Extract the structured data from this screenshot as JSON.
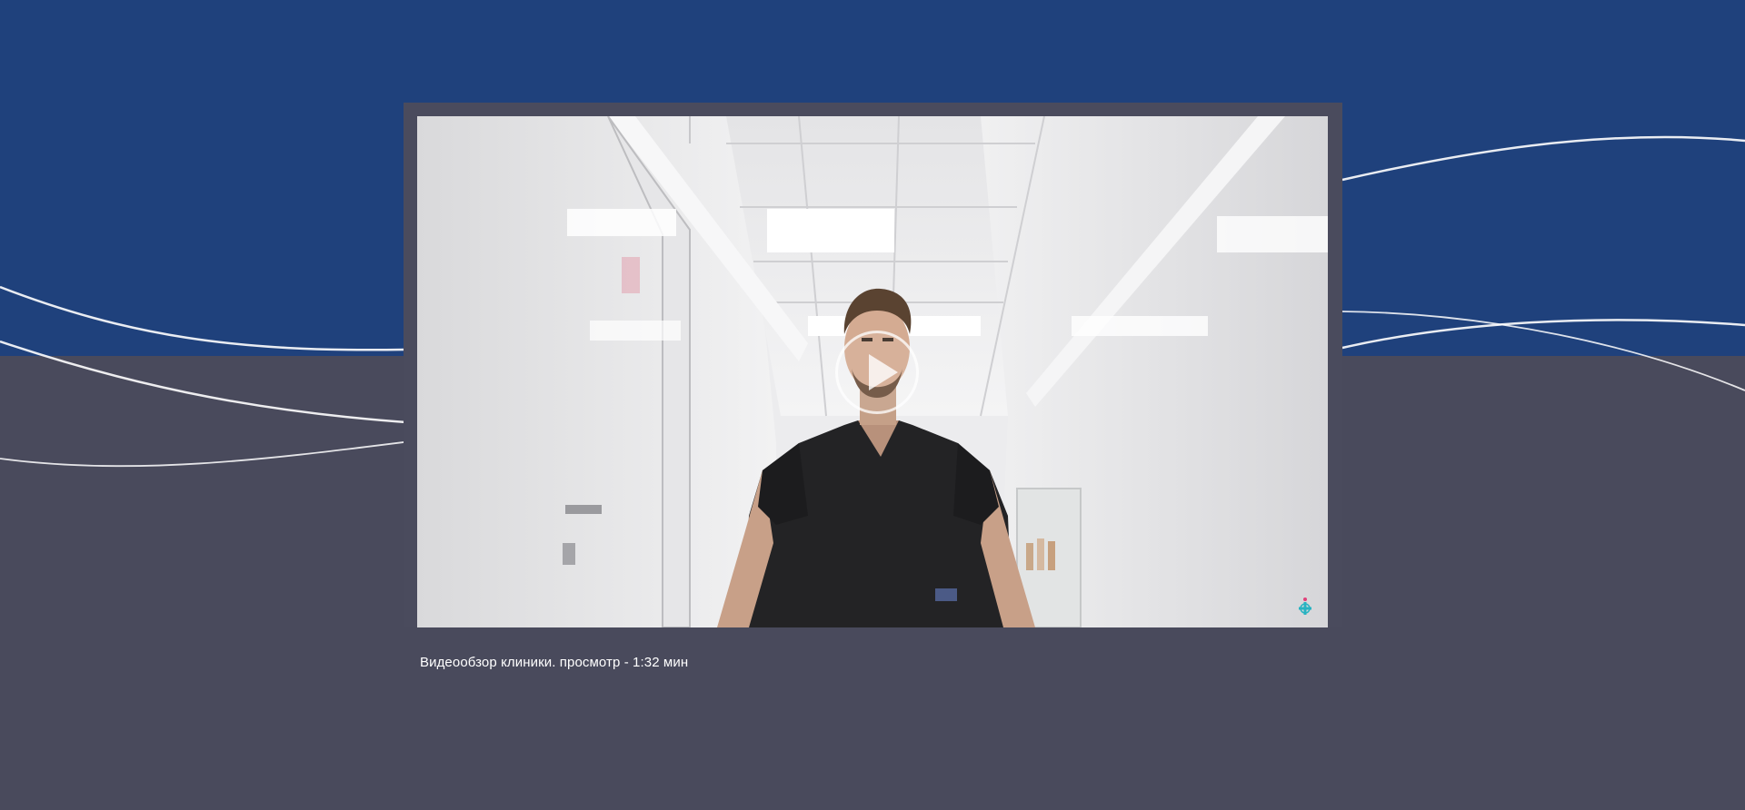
{
  "colors": {
    "top_band": "#1f417c",
    "bottom_band": "#494a5c",
    "frame": "#4a4b5d",
    "wave_lines": "#ffffff",
    "caption_text": "#ffffff"
  },
  "video": {
    "thumbnail_scene": "clinic-corridor-doctor",
    "play_icon": "play-icon",
    "logo_icon": "clinic-logo-icon",
    "caption": "Видеообзор клиники. просмотр - 1:32 мин"
  }
}
